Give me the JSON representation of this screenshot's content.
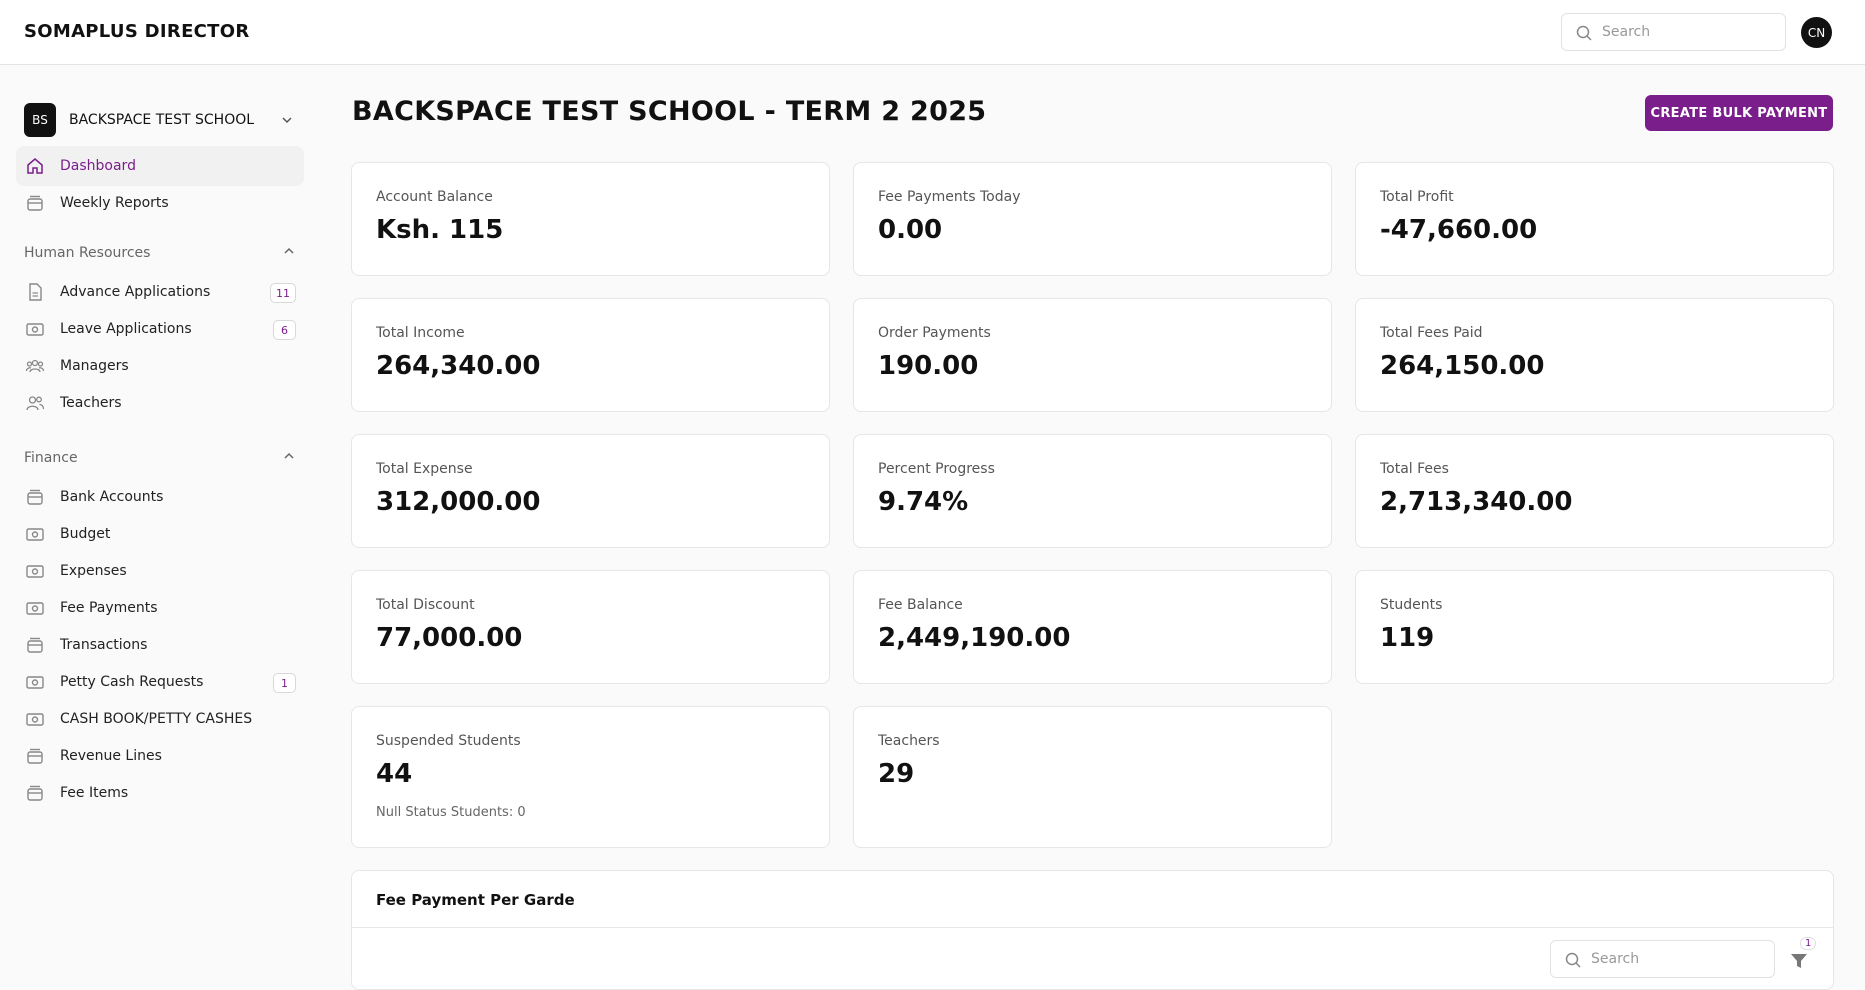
{
  "app": {
    "brand": "SOMAPLUS DIRECTOR"
  },
  "header": {
    "search_placeholder": "Search",
    "avatar_initials": "CN"
  },
  "school": {
    "badge": "BS",
    "name": "BACKSPACE TEST SCHOOL"
  },
  "sidebar": {
    "top_items": [
      {
        "label": "Dashboard",
        "icon": "home-icon",
        "active": true
      },
      {
        "label": "Weekly Reports",
        "icon": "archive-icon"
      }
    ],
    "sections": [
      {
        "title": "Human Resources",
        "items": [
          {
            "label": "Advance Applications",
            "icon": "document-icon",
            "badge": "11"
          },
          {
            "label": "Leave Applications",
            "icon": "banknote-icon",
            "badge": "6"
          },
          {
            "label": "Managers",
            "icon": "users-group-icon"
          },
          {
            "label": "Teachers",
            "icon": "users-icon"
          }
        ]
      },
      {
        "title": "Finance",
        "items": [
          {
            "label": "Bank Accounts",
            "icon": "archive-icon"
          },
          {
            "label": "Budget",
            "icon": "banknote-icon"
          },
          {
            "label": "Expenses",
            "icon": "banknote-icon"
          },
          {
            "label": "Fee Payments",
            "icon": "banknote-icon"
          },
          {
            "label": "Transactions",
            "icon": "archive-icon"
          },
          {
            "label": "Petty Cash Requests",
            "icon": "banknote-icon",
            "badge": "1"
          },
          {
            "label": "CASH BOOK/PETTY CASHES",
            "icon": "banknote-icon"
          },
          {
            "label": "Revenue Lines",
            "icon": "archive-icon"
          },
          {
            "label": "Fee Items",
            "icon": "archive-icon"
          }
        ]
      }
    ]
  },
  "main": {
    "title": "BACKSPACE TEST SCHOOL - TERM 2 2025",
    "bulk_payment_label": "CREATE BULK PAYMENT",
    "stats": [
      {
        "label": "Account Balance",
        "value": "Ksh. 115"
      },
      {
        "label": "Fee Payments Today",
        "value": "0.00"
      },
      {
        "label": "Total Profit",
        "value": "-47,660.00"
      },
      {
        "label": "Total Income",
        "value": "264,340.00"
      },
      {
        "label": "Order Payments",
        "value": "190.00"
      },
      {
        "label": "Total Fees Paid",
        "value": "264,150.00"
      },
      {
        "label": "Total Expense",
        "value": "312,000.00"
      },
      {
        "label": "Percent Progress",
        "value": "9.74%"
      },
      {
        "label": "Total Fees",
        "value": "2,713,340.00"
      },
      {
        "label": "Total Discount",
        "value": "77,000.00"
      },
      {
        "label": "Fee Balance",
        "value": "2,449,190.00"
      },
      {
        "label": "Students",
        "value": "119"
      },
      {
        "label": "Suspended Students",
        "value": "44",
        "note": "Null Status Students: 0"
      },
      {
        "label": "Teachers",
        "value": "29"
      }
    ],
    "fee_panel": {
      "title": "Fee Payment Per Garde",
      "search_placeholder": "Search",
      "filter_count": "1"
    }
  },
  "colors": {
    "accent": "#7a1e8c",
    "background": "#fafafa"
  }
}
